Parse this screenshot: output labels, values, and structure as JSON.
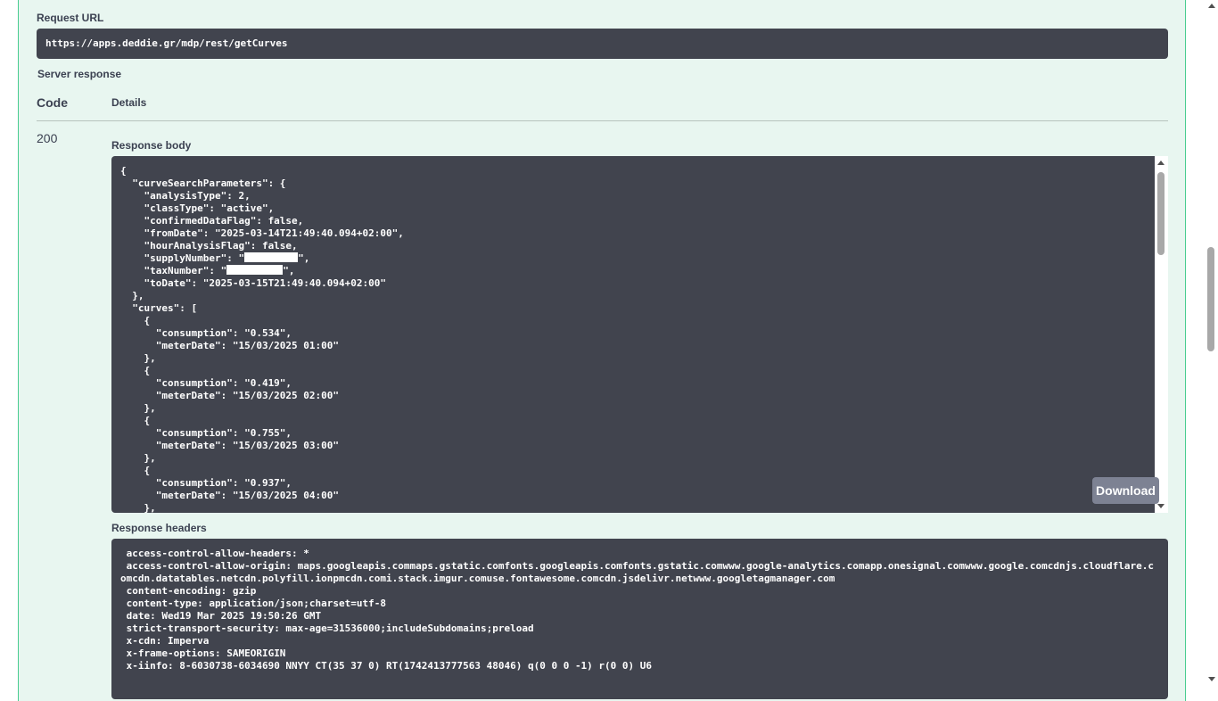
{
  "request_url": {
    "label": "Request URL",
    "value": "https://apps.deddie.gr/mdp/rest/getCurves"
  },
  "server_response": {
    "label": "Server response",
    "code_header": "Code",
    "details_header": "Details",
    "status_code": "200"
  },
  "response_body": {
    "label": "Response body",
    "lines_before_redaction": "{\n  \"curveSearchParameters\": {\n    \"analysisType\": 2,\n    \"classType\": \"active\",\n    \"confirmedDataFlag\": false,\n    \"fromDate\": \"2025-03-14T21:49:40.094+02:00\",\n    \"hourAnalysisFlag\": false,",
    "supply_prefix": "    \"supplyNumber\": \"",
    "supply_suffix": "\",",
    "tax_prefix": "    \"taxNumber\": \"",
    "tax_suffix": "\",",
    "lines_after_redaction": "    \"toDate\": \"2025-03-15T21:49:40.094+02:00\"\n  },\n  \"curves\": [\n    {\n      \"consumption\": \"0.534\",\n      \"meterDate\": \"15/03/2025 01:00\"\n    },\n    {\n      \"consumption\": \"0.419\",\n      \"meterDate\": \"15/03/2025 02:00\"\n    },\n    {\n      \"consumption\": \"0.755\",\n      \"meterDate\": \"15/03/2025 03:00\"\n    },\n    {\n      \"consumption\": \"0.937\",\n      \"meterDate\": \"15/03/2025 04:00\"\n    },",
    "download_label": "Download"
  },
  "response_headers": {
    "label": "Response headers",
    "text": " access-control-allow-headers: *\n access-control-allow-origin: maps.googleapis.commaps.gstatic.comfonts.googleapis.comfonts.gstatic.comwww.google-analytics.comapp.onesignal.comwww.google.comcdnjs.cloudflare.comcdn.datatables.netcdn.polyfill.ionpmcdn.comi.stack.imgur.comuse.fontawesome.comcdn.jsdelivr.netwww.googletagmanager.com\n content-encoding: gzip\n content-type: application/json;charset=utf-8\n date: Wed19 Mar 2025 19:50:26 GMT\n strict-transport-security: max-age=31536000;includeSubdomains;preload\n x-cdn: Imperva\n x-frame-options: SAMEORIGIN\n x-iinfo: 8-6030738-6034690 NNYY CT(35 37 0) RT(1742413777563 48046) q(0 0 0 -1) r(0 0) U6"
  },
  "colors": {
    "panel_bg": "#e8f6f0",
    "panel_border": "#49cc90",
    "code_bg": "#41444e",
    "button_bg": "#7d8293"
  }
}
